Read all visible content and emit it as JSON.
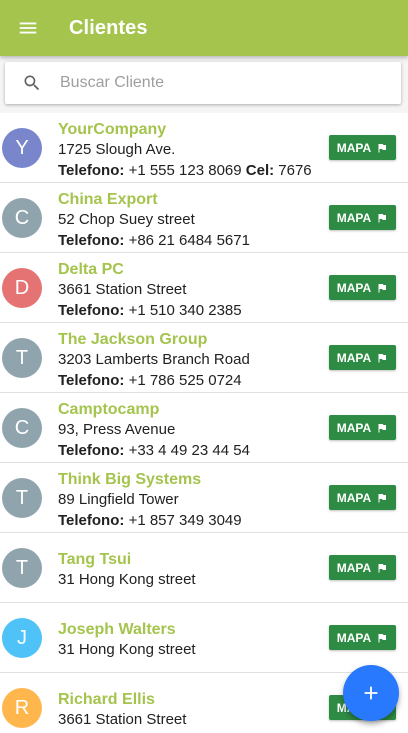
{
  "appbar": {
    "title": "Clientes",
    "menu_icon": "menu-icon"
  },
  "search": {
    "placeholder": "Buscar Cliente",
    "value": "",
    "icon": "search-icon"
  },
  "colors": {
    "appbar": "#a4c44d",
    "name_text": "#a4c44d",
    "map_button": "#2e8b44",
    "fab": "#2979ff",
    "avatar_indigo": "#7986cb",
    "avatar_gray": "#90a4ae",
    "avatar_red": "#e57373",
    "avatar_lightblue": "#4fc3f7",
    "avatar_orange": "#ffb74d"
  },
  "phone_label": "Telefono:",
  "mobile_label": "Cel:",
  "map_button_label": "MAPA",
  "clients": [
    {
      "initial": "Y",
      "avatar_color": "#7986cb",
      "name": "YourCompany",
      "address": "1725 Slough Ave.",
      "phone": "+1 555 123 8069",
      "mobile": "7676"
    },
    {
      "initial": "C",
      "avatar_color": "#90a4ae",
      "name": "China Export",
      "address": "52 Chop Suey street",
      "phone": "+86 21 6484 5671"
    },
    {
      "initial": "D",
      "avatar_color": "#e57373",
      "name": "Delta PC",
      "address": "3661 Station Street",
      "phone": "+1 510 340 2385"
    },
    {
      "initial": "T",
      "avatar_color": "#90a4ae",
      "name": "The Jackson Group",
      "address": "3203 Lamberts Branch Road",
      "phone": "+1 786 525 0724"
    },
    {
      "initial": "C",
      "avatar_color": "#90a4ae",
      "name": "Camptocamp",
      "address": "93, Press Avenue",
      "phone": "+33 4 49 23 44 54"
    },
    {
      "initial": "T",
      "avatar_color": "#90a4ae",
      "name": "Think Big Systems",
      "address": "89 Lingfield Tower",
      "phone": "+1 857 349 3049"
    },
    {
      "initial": "T",
      "avatar_color": "#90a4ae",
      "name": "Tang Tsui",
      "address": "31 Hong Kong street"
    },
    {
      "initial": "J",
      "avatar_color": "#4fc3f7",
      "name": "Joseph Walters",
      "address": "31 Hong Kong street"
    },
    {
      "initial": "R",
      "avatar_color": "#ffb74d",
      "name": "Richard Ellis",
      "address": "3661 Station Street"
    }
  ],
  "fab": {
    "icon": "plus-icon"
  }
}
